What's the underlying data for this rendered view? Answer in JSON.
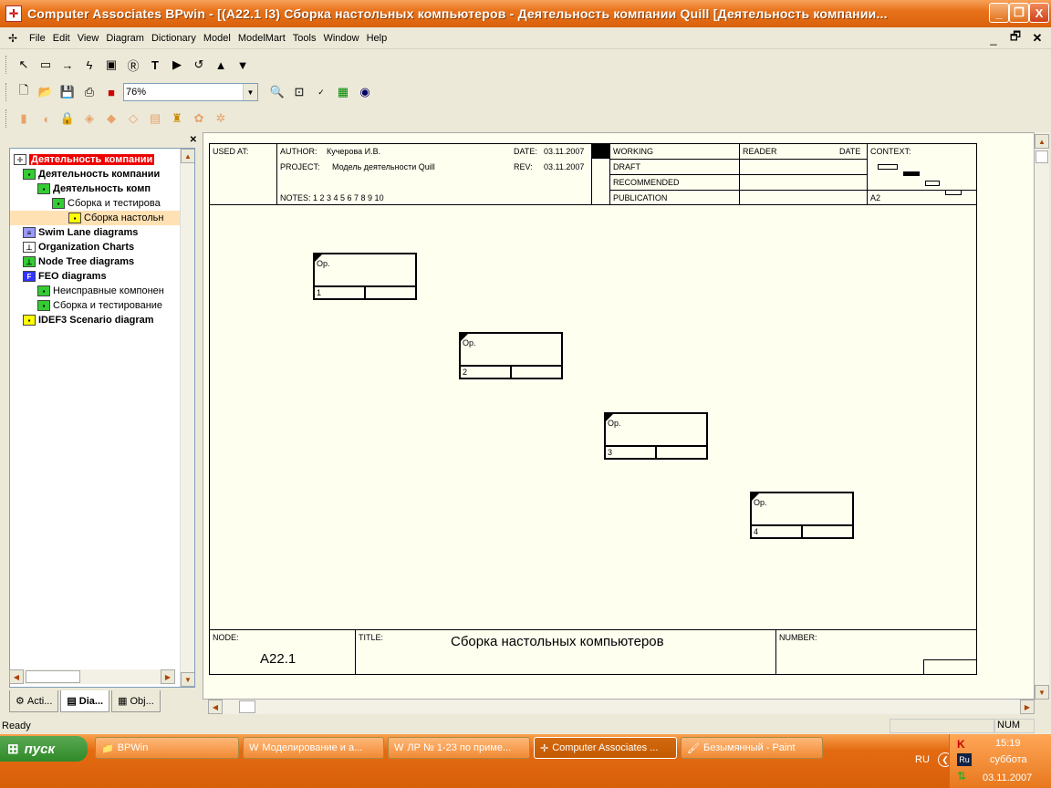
{
  "window": {
    "title": "Computer Associates BPwin - [(A22.1 l3) Сборка настольных компьютеров - Деятельность компании Quill  [Деятельность компании...",
    "minimize": "_",
    "restore": "❐",
    "close": "X"
  },
  "menu": [
    "File",
    "Edit",
    "View",
    "Diagram",
    "Dictionary",
    "Model",
    "ModelMart",
    "Tools",
    "Window",
    "Help"
  ],
  "toolbar": {
    "zoom_value": "76%"
  },
  "tree": {
    "root": "Деятельность компании",
    "items": [
      "Деятельность компании",
      "Деятельность комп",
      "Сборка и тестирова",
      "Сборка настольн",
      "Swim Lane diagrams",
      "Organization Charts",
      "Node Tree diagrams",
      "FEO diagrams",
      "Неисправные компонен",
      "Сборка и тестирование",
      "IDEF3 Scenario diagram"
    ]
  },
  "tabs": [
    "Acti...",
    "Dia...",
    "Obj..."
  ],
  "diagram": {
    "header": {
      "used_at": "USED AT:",
      "author_label": "AUTHOR:",
      "author": "Кучерова И.В.",
      "project_label": "PROJECT:",
      "project": "Модель деятельности Quill",
      "date_label": "DATE:",
      "date": "03.11.2007",
      "rev_label": "REV:",
      "rev": "03.11.2007",
      "notes": "NOTES:  1  2  3  4  5  6  7  8  9  10",
      "status": [
        "WORKING",
        "DRAFT",
        "RECOMMENDED",
        "PUBLICATION"
      ],
      "reader": "READER",
      "reader_date": "DATE",
      "context": "CONTEXT:",
      "context_node": "A2"
    },
    "boxes": [
      {
        "label": "Op.",
        "num": "1"
      },
      {
        "label": "Op.",
        "num": "2"
      },
      {
        "label": "Op.",
        "num": "3"
      },
      {
        "label": "Op.",
        "num": "4"
      }
    ],
    "footer": {
      "node_label": "NODE:",
      "node": "A22.1",
      "title_label": "TITLE:",
      "title": "Сборка настольных компьютеров",
      "number_label": "NUMBER:"
    }
  },
  "statusbar": {
    "text": "Ready",
    "num": "NUM"
  },
  "taskbar": {
    "start": "пуск",
    "tasks": [
      "BPWin",
      "Моделирование и а...",
      "ЛР № 1-23 по приме...",
      "Computer Associates ...",
      "Безымянный - Paint"
    ],
    "lang": "RU",
    "time": "15:19",
    "day": "суббота",
    "date": "03.11.2007"
  }
}
